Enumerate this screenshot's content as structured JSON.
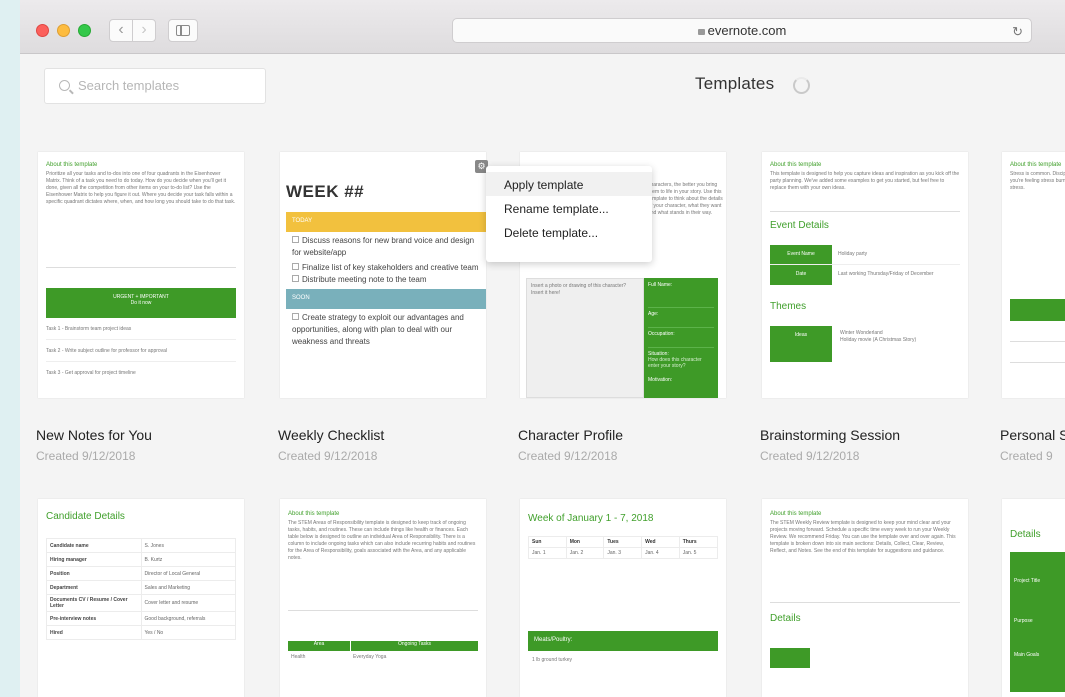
{
  "browser": {
    "url": "evernote.com",
    "reload": "↻",
    "back": "‹",
    "forward": "›"
  },
  "header": {
    "search_placeholder": "Search templates",
    "title": "Templates"
  },
  "context_menu": {
    "items": [
      "Apply template",
      "Rename template...",
      "Delete template..."
    ]
  },
  "cards": [
    {
      "name": "New Notes for You",
      "created": "Created 9/12/2018"
    },
    {
      "name": "Weekly Checklist",
      "created": "Created 9/12/2018"
    },
    {
      "name": "Character Profile",
      "created": "Created 9/12/2018"
    },
    {
      "name": "Brainstorming Session",
      "created": "Created 9/12/2018"
    },
    {
      "name": "Personal S",
      "created": "Created 9"
    }
  ],
  "previews": {
    "about": "About this template",
    "urgent": "URGENT + IMPORTANT",
    "urgent_sub": "Do it now",
    "task1": "Task 1 - Brainstorm team project ideas",
    "task2": "Task 2 - Write subject outline for professor for approval",
    "task3": "Task 3 - Get approval for project timeline",
    "week": "WEEK ##",
    "today": "TODAY",
    "soon": "SOON",
    "chk1": "Discuss reasons for new brand voice and design for website/app",
    "chk2": "Finalize list of key stakeholders and creative team",
    "chk3": "Distribute meeting note to the team",
    "chk4": "Create strategy to exploit our advantages and opportunities, along with plan to deal with our weakness and threats",
    "photo": "Insert a photo or drawing of this character? Insert it here!",
    "full_name": "Full Name:",
    "age": "Age:",
    "occupation": "Occupation:",
    "situation": "Situation:",
    "situation_q": "How does this character enter your story?",
    "motivation": "Motivation:",
    "event_details": "Event Details",
    "event_name": "Event Name",
    "event_val": "Holiday party",
    "date": "Date",
    "date_val": "Last working Thursday/Friday of December",
    "themes": "Themes",
    "ideas": "Ideas",
    "idea1": "Winter Wonderland",
    "idea2": "Holiday movie (A Christmas Story)",
    "candidate": "Candidate Details",
    "cand_rows": [
      [
        "Candidate name",
        "S. Jones"
      ],
      [
        "Hiring manager",
        "B. Kurtz"
      ],
      [
        "Position",
        "Director of Local General"
      ],
      [
        "Department",
        "Sales and Marketing"
      ],
      [
        "Documents CV / Resume / Cover Letter",
        "Cover letter and resume"
      ],
      [
        "Pre-interview notes",
        "Good background, referrals"
      ],
      [
        "Hired",
        "Yes / No"
      ]
    ],
    "week_range": "Week of January 1 - 7, 2018",
    "days": [
      "Sun",
      "Mon",
      "Tues",
      "Wed",
      "Thurs"
    ],
    "dates": [
      "Jan. 1",
      "Jan. 2",
      "Jan. 3",
      "Jan. 4",
      "Jan. 5"
    ],
    "meats": "Meats/Poultry:",
    "meat1": "1 lb ground turkey",
    "area": "Area",
    "ongoing": "Ongoing Tasks",
    "health": "Health",
    "health_task": "Everyday Yoga",
    "details": "Details",
    "project_title": "Project Title",
    "purpose": "Purpose",
    "main_goals": "Main Goals"
  }
}
